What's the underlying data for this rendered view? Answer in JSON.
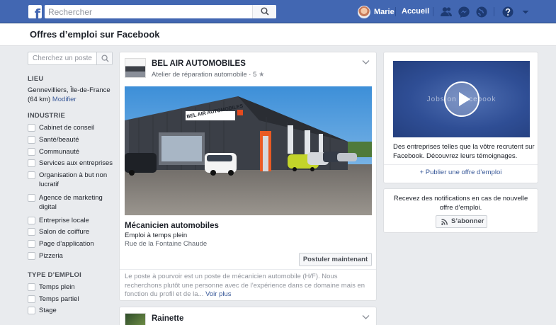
{
  "topbar": {
    "search_placeholder": "Rechercher",
    "user_name": "Marie",
    "home_label": "Accueil",
    "icons": [
      "facebook-logo-icon",
      "search-icon",
      "friends-icon",
      "messenger-icon",
      "globe-icon",
      "help-icon",
      "caret-down-icon"
    ]
  },
  "page": {
    "title": "Offres d’emploi sur Facebook"
  },
  "filters": {
    "search_placeholder": "Cherchez un poste",
    "location": {
      "title": "LIEU",
      "value": "Gennevilliers, Île-de-France (64 km)",
      "modify_label": "Modifier"
    },
    "industry": {
      "title": "INDUSTRIE",
      "items": [
        "Cabinet de conseil",
        "Santé/beauté",
        "Communauté",
        "Services aux entreprises",
        "Organisation à but non lucratif",
        "Agence de marketing digital",
        "Entreprise locale",
        "Salon de coiffure",
        "Page d’application",
        "Pizzeria"
      ]
    },
    "job_type": {
      "title": "TYPE D’EMPLOI",
      "items": [
        "Temps plein",
        "Temps partiel",
        "Stage"
      ]
    }
  },
  "jobs": [
    {
      "company": "BEL AIR AUTOMOBILES",
      "category": "Atelier de réparation automobile · 5",
      "star": "★",
      "photo_sign": "BEL AIR AUTOMOBILES",
      "title": "Mécanicien automobiles",
      "type": "Emploi à temps plein",
      "address": "Rue de la Fontaine Chaude",
      "apply_label": "Postuler maintenant",
      "description": "Le poste à pourvoir est un poste de mécanicien automobile (H/F). Nous recherchons plutôt une personne avec de l’expérience dans ce domaine mais en fonction du profil et de la...",
      "see_more": "Voir plus"
    },
    {
      "company": "Rainette"
    }
  ],
  "sidebar": {
    "video_text": "Jobs on Facebook",
    "promo_text": "Des entreprises telles que la vôtre recrutent sur Facebook. Découvrez leurs témoignages.",
    "post_job_label": "+ Publier une offre d’emploi",
    "notif_text": "Recevez des notifications en cas de nouvelle offre d’emploi.",
    "subscribe_label": "S’abonner"
  },
  "colors": {
    "brand": "#4267b2",
    "link": "#385898",
    "background": "#e9ebee"
  }
}
